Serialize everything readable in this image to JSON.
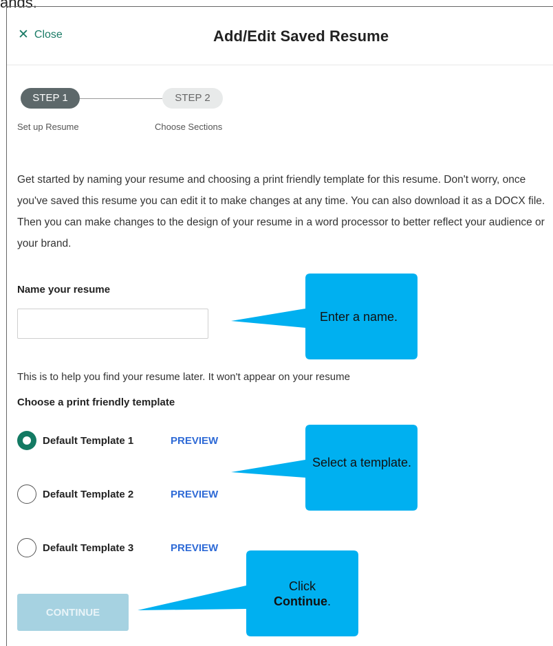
{
  "header": {
    "close_label": "Close",
    "title": "Add/Edit Saved Resume"
  },
  "stepper": {
    "steps": [
      {
        "pill": "STEP 1",
        "caption": "Set up Resume",
        "state": "active"
      },
      {
        "pill": "STEP 2",
        "caption": "Choose Sections",
        "state": "inactive"
      }
    ]
  },
  "intro": "Get started by naming your resume and choosing a print friendly template for this resume. Don't worry, once you've saved this resume you can edit it to make changes at any time. You can also download it as a DOCX file. Then you can make changes to the design of your resume in a word processor to better reflect your audience or your brand.",
  "name_section": {
    "label": "Name your resume",
    "input_value": "",
    "helper": "This is to help you find your resume later. It won't appear on your resume"
  },
  "template_section": {
    "label": "Choose a print friendly template",
    "options": [
      {
        "label": "Default Template 1",
        "preview": "PREVIEW",
        "checked": true
      },
      {
        "label": "Default Template 2",
        "preview": "PREVIEW",
        "checked": false
      },
      {
        "label": "Default Template 3",
        "preview": "PREVIEW",
        "checked": false
      }
    ]
  },
  "continue_label": "CONTINUE",
  "callouts": {
    "name": "Enter a name.",
    "template": "Select a template.",
    "continue_line1": "Click",
    "continue_bold": "Continue",
    "continue_tail": "."
  },
  "colors": {
    "accent": "#1a7b66",
    "radio_checked": "#137a63",
    "preview_link": "#2e6ad6",
    "continue_disabled": "#a6d2e1",
    "callout": "#00b0f0",
    "step_active": "#5d686a",
    "step_inactive": "#e8eaea"
  },
  "icons": {
    "close": "close-x-icon",
    "radio_checked": "radio-checked-icon",
    "radio_unchecked": "radio-unchecked-icon"
  }
}
